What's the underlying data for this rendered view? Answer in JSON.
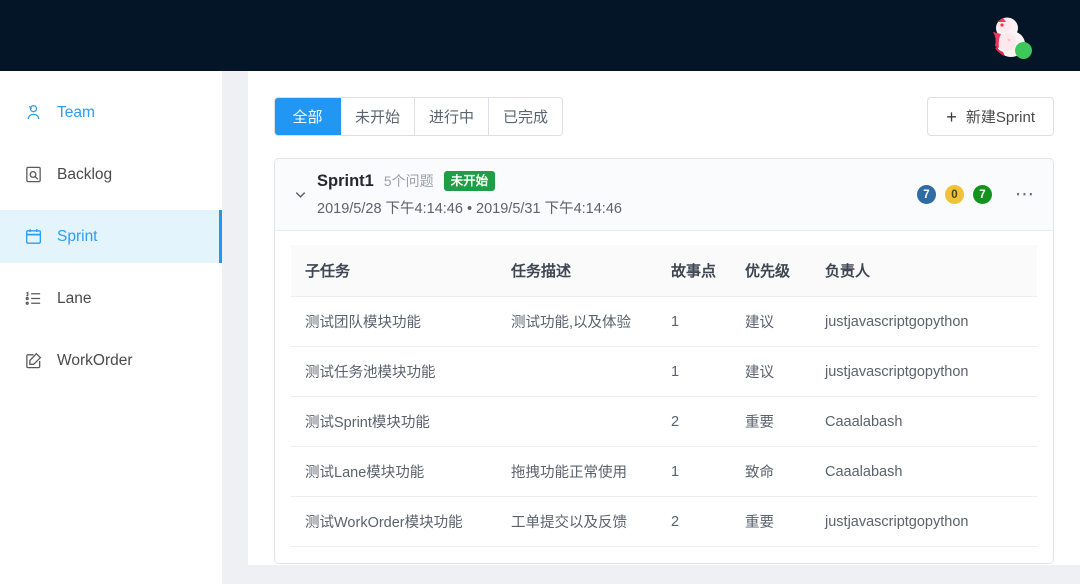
{
  "topbar": {
    "avatar": {
      "name": "user-avatar",
      "status": "online",
      "status_color": "#3ec75a"
    },
    "background_color": "#041527"
  },
  "sidebar": {
    "items": [
      {
        "label": "Team",
        "icon": "team-icon",
        "active": false,
        "highlighted": true
      },
      {
        "label": "Backlog",
        "icon": "backlog-icon",
        "active": false,
        "highlighted": false
      },
      {
        "label": "Sprint",
        "icon": "calendar-icon",
        "active": true,
        "highlighted": false
      },
      {
        "label": "Lane",
        "icon": "list-icon",
        "active": false,
        "highlighted": false
      },
      {
        "label": "WorkOrder",
        "icon": "edit-note-icon",
        "active": false,
        "highlighted": false
      }
    ],
    "active_color": "#2196f3",
    "active_bg": "#e4f4fd"
  },
  "toolbar": {
    "filters": [
      {
        "label": "全部",
        "active": true
      },
      {
        "label": "未开始",
        "active": false
      },
      {
        "label": "进行中",
        "active": false
      },
      {
        "label": "已完成",
        "active": false
      }
    ],
    "new_sprint": {
      "label": "新建Sprint",
      "icon": "plus-icon"
    }
  },
  "sprint": {
    "collapse_icon": "chevron-down-icon",
    "name": "Sprint1",
    "issue_count": "5个问题",
    "status": "未开始",
    "status_color": "#1e9e45",
    "dates": "2019/5/28 下午4:14:46 • 2019/5/31 下午4:14:46",
    "badges": [
      {
        "value": "7",
        "color": "#2f6ca3",
        "variant": "blue"
      },
      {
        "value": "0",
        "color": "#f0c239",
        "variant": "yellow"
      },
      {
        "value": "7",
        "color": "#13921f",
        "variant": "green"
      }
    ],
    "more_icon": "ellipsis-icon"
  },
  "table": {
    "columns": [
      "子任务",
      "任务描述",
      "故事点",
      "优先级",
      "负责人"
    ],
    "rows": [
      {
        "subtask": "测试团队模块功能",
        "description": "测试功能,以及体验",
        "points": "1",
        "priority": "建议",
        "owner": "justjavascriptgopython"
      },
      {
        "subtask": "测试任务池模块功能",
        "description": "",
        "points": "1",
        "priority": "建议",
        "owner": "justjavascriptgopython"
      },
      {
        "subtask": "测试Sprint模块功能",
        "description": "",
        "points": "2",
        "priority": "重要",
        "owner": "Caaalabash"
      },
      {
        "subtask": "测试Lane模块功能",
        "description": "拖拽功能正常使用",
        "points": "1",
        "priority": "致命",
        "owner": "Caaalabash"
      },
      {
        "subtask": "测试WorkOrder模块功能",
        "description": "工单提交以及反馈",
        "points": "2",
        "priority": "重要",
        "owner": "justjavascriptgopython"
      }
    ]
  }
}
